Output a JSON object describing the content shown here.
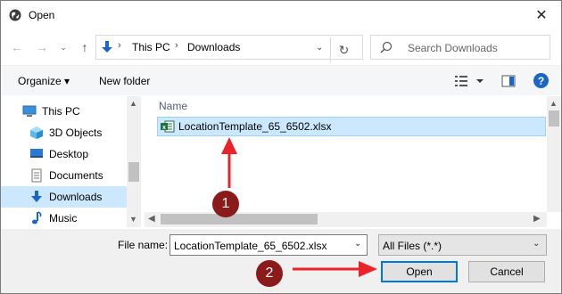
{
  "window": {
    "title": "Open"
  },
  "address": {
    "crumbs": [
      "This PC",
      "Downloads"
    ]
  },
  "search": {
    "placeholder": "Search Downloads"
  },
  "toolbar": {
    "organize": "Organize ▾",
    "new_folder": "New folder",
    "help": "?"
  },
  "nav": {
    "items": [
      {
        "label": "This PC",
        "icon": "computer-icon"
      },
      {
        "label": "3D Objects",
        "icon": "3d-objects-icon"
      },
      {
        "label": "Desktop",
        "icon": "desktop-icon"
      },
      {
        "label": "Documents",
        "icon": "documents-icon"
      },
      {
        "label": "Downloads",
        "icon": "downloads-icon",
        "selected": true
      },
      {
        "label": "Music",
        "icon": "music-icon"
      }
    ]
  },
  "files": {
    "column_name": "Name",
    "rows": [
      {
        "name": "LocationTemplate_65_6502.xlsx",
        "icon": "excel-file-icon",
        "selected": true
      }
    ]
  },
  "bottom": {
    "file_name_label": "File name:",
    "file_name_value": "LocationTemplate_65_6502.xlsx",
    "file_type": "All Files (*.*)",
    "open_label": "Open",
    "cancel_label": "Cancel"
  },
  "annotations": {
    "step1": "1",
    "step2": "2",
    "color": "#8b1a1a",
    "arrow_color": "#e8232a"
  },
  "colors": {
    "selection": "#cce8ff",
    "accent": "#0078d7"
  }
}
